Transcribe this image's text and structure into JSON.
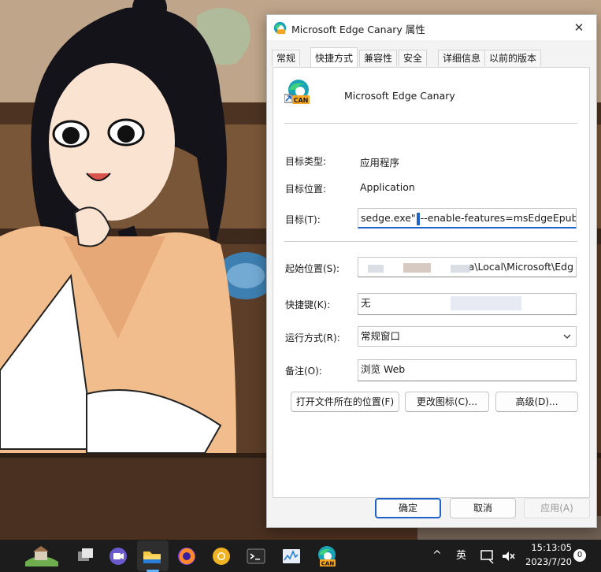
{
  "window": {
    "title": "Microsoft Edge Canary 属性",
    "close_glyph": "✕"
  },
  "tabs": [
    {
      "label": "常规",
      "active": false
    },
    {
      "label": "快捷方式",
      "active": true
    },
    {
      "label": "兼容性",
      "active": false
    },
    {
      "label": "安全",
      "active": false
    },
    {
      "label": "详细信息",
      "active": false
    },
    {
      "label": "以前的版本",
      "active": false
    }
  ],
  "app": {
    "name": "Microsoft Edge Canary",
    "icon_badge": "CAN"
  },
  "fields": {
    "target_type_label": "目标类型:",
    "target_type_value": "应用程序",
    "target_location_label": "目标位置:",
    "target_location_value": "Application",
    "target_label": "目标(T):",
    "target_value_before_caret": "sedge.exe\"",
    "target_value_after_caret": "--enable-features=msEdgeEpubRea",
    "start_in_label": "起始位置(S):",
    "start_in_value": "a\\Local\\Microsoft\\Edg",
    "shortcut_key_label": "快捷键(K):",
    "shortcut_key_value": "无",
    "run_label": "运行方式(R):",
    "run_value": "常规窗口",
    "comment_label": "备注(O):",
    "comment_value": "浏览 Web"
  },
  "page_buttons": {
    "open_location": "打开文件所在的位置(F)",
    "change_icon": "更改图标(C)...",
    "advanced": "高级(D)..."
  },
  "dialog_buttons": {
    "ok": "确定",
    "cancel": "取消",
    "apply": "应用(A)"
  },
  "taskbar": {
    "ime": "英",
    "time": "15:13:05",
    "date": "2023/7/20",
    "notifications": "0",
    "chevron": "^"
  },
  "colors": {
    "accent": "#1e64c8",
    "taskbar": "#1c1c1c",
    "dialog_bg": "#f3f3f3"
  }
}
